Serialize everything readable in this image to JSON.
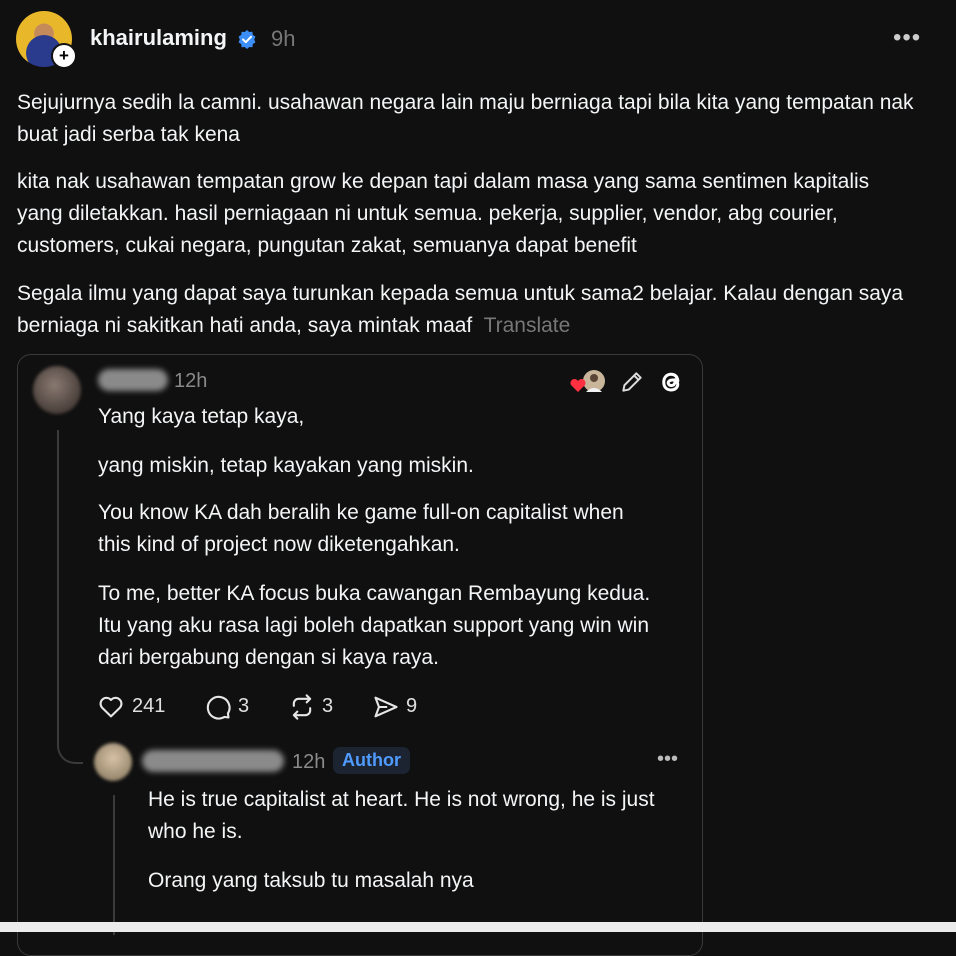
{
  "post": {
    "username": "khairulaming",
    "time": "9h",
    "paragraphs": [
      "Sejujurnya sedih la camni. usahawan negara lain maju berniaga tapi bila kita yang tempatan nak buat jadi serba tak kena",
      "kita nak usahawan tempatan grow ke depan tapi dalam masa yang sama sentimen kapitalis yang diletakkan. hasil perniagaan ni untuk semua. pekerja, supplier, vendor, abg courier, customers, cukai negara, pungutan zakat, semuanya dapat benefit",
      "Segala ilmu yang dapat saya turunkan kepada semua untuk sama2 belajar. Kalau dengan saya berniaga ni sakitkan hati anda, saya mintak maaf"
    ],
    "translate_label": "Translate",
    "follow_icon": "plus-icon",
    "menu_icon": "more-icon"
  },
  "quoted": {
    "time": "12h",
    "paragraphs": [
      "Yang kaya tetap kaya,",
      "yang miskin, tetap kayakan yang miskin.",
      "You know KA dah beralih ke game full-on capitalist when this kind of project now diketengahkan.",
      "To me, better KA focus buka cawangan Rembayung kedua. Itu yang aku rasa lagi boleh dapatkan support yang win win dari bergabung dengan si kaya raya."
    ],
    "stats": {
      "likes": "241",
      "comments": "3",
      "reposts": "3",
      "shares": "9"
    }
  },
  "reply": {
    "time": "12h",
    "badge": "Author",
    "paragraphs": [
      "He is true capitalist at heart. He is not wrong, he is just who he is.",
      "Orang yang taksub tu masalah nya"
    ]
  },
  "colors": {
    "background": "#101010",
    "text": "#f3f5f7",
    "muted": "#777777",
    "verified": "#3a8ef6",
    "author_badge": "#4f9bff"
  }
}
